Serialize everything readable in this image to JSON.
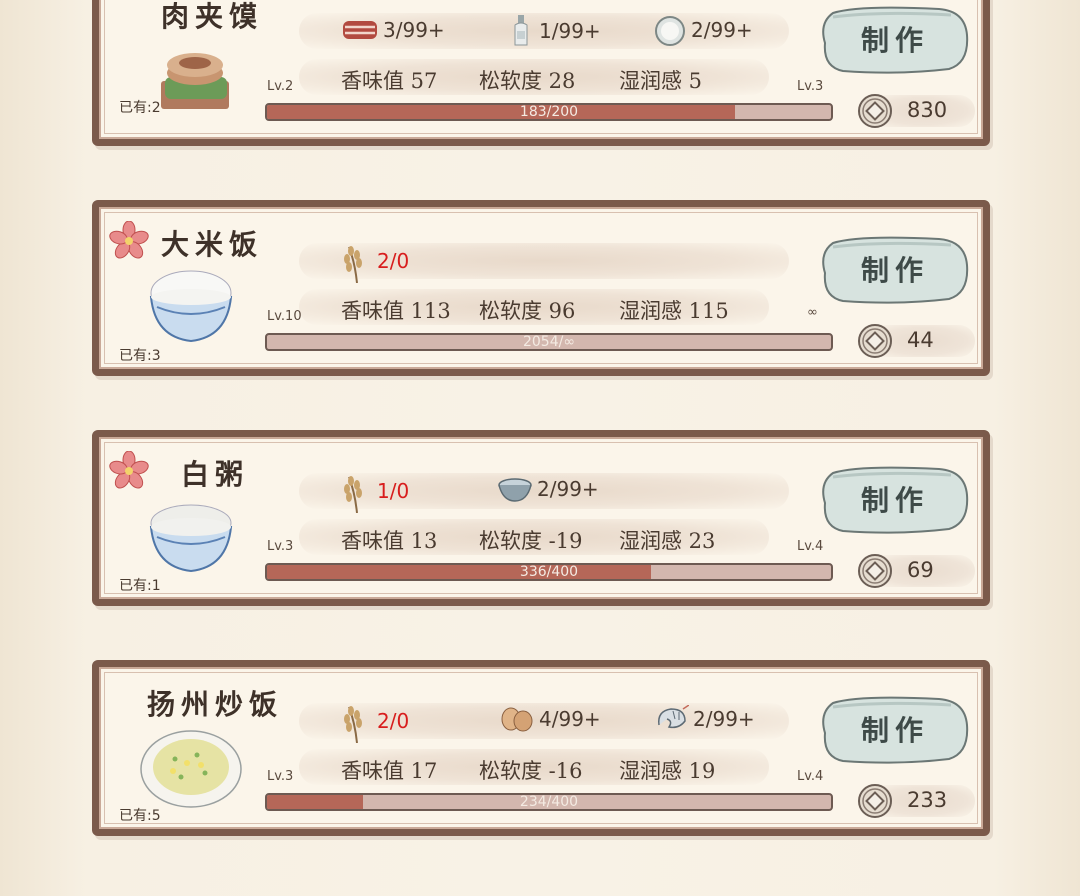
{
  "make_label": "制作",
  "recipes": [
    {
      "name": "肉夹馍",
      "owned": "已有:2",
      "show_flower": false,
      "ingredients": [
        {
          "icon": "meat-icon",
          "count": "3/99+",
          "insufficient": false
        },
        {
          "icon": "bottle-icon",
          "count": "1/99+",
          "insufficient": false
        },
        {
          "icon": "flour-bowl-icon",
          "count": "2/99+",
          "insufficient": false
        }
      ],
      "stats": {
        "aroma": "香味值 57",
        "softness": "松软度 28",
        "moisture": "湿润感 5"
      },
      "level": "Lv.2",
      "next_level": "Lv.3",
      "progress_text": "183/200",
      "progress_fraction": 0.83,
      "price": "830"
    },
    {
      "name": "大米饭",
      "owned": "已有:3",
      "show_flower": true,
      "ingredients": [
        {
          "icon": "rice-stalk-icon",
          "count": "2/0",
          "insufficient": true
        }
      ],
      "stats": {
        "aroma": "香味值 113",
        "softness": "松软度 96",
        "moisture": "湿润感 115"
      },
      "level": "Lv.10",
      "next_level": "∞",
      "progress_text": "2054/∞",
      "progress_fraction": 0.0,
      "price": "44"
    },
    {
      "name": "白粥",
      "owned": "已有:1",
      "show_flower": true,
      "ingredients": [
        {
          "icon": "rice-stalk-icon",
          "count": "1/0",
          "insufficient": true
        },
        {
          "icon": "water-bowl-icon",
          "count": "2/99+",
          "insufficient": false
        }
      ],
      "stats": {
        "aroma": "香味值 13",
        "softness": "松软度 -19",
        "moisture": "湿润感 23"
      },
      "level": "Lv.3",
      "next_level": "Lv.4",
      "progress_text": "336/400",
      "progress_fraction": 0.68,
      "price": "69"
    },
    {
      "name": "扬州炒饭",
      "owned": "已有:5",
      "show_flower": false,
      "ingredients": [
        {
          "icon": "rice-stalk-icon",
          "count": "2/0",
          "insufficient": true
        },
        {
          "icon": "egg-icon",
          "count": "4/99+",
          "insufficient": false
        },
        {
          "icon": "shrimp-icon",
          "count": "2/99+",
          "insufficient": false
        }
      ],
      "stats": {
        "aroma": "香味值 17",
        "softness": "松软度 -16",
        "moisture": "湿润感 19"
      },
      "level": "Lv.3",
      "next_level": "Lv.4",
      "progress_text": "234/400",
      "progress_fraction": 0.17,
      "price": "233"
    }
  ]
}
